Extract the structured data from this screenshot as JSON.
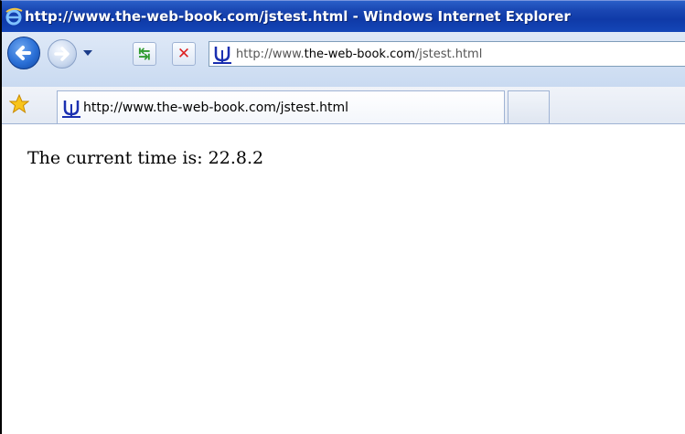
{
  "window": {
    "title": "http://www.the-web-book.com/jstest.html - Windows Internet Explorer"
  },
  "navbar": {
    "address_prefix": "http://www.",
    "address_domain": "the-web-book.com",
    "address_path": "/jstest.html"
  },
  "tab": {
    "title": "http://www.the-web-book.com/jstest.html"
  },
  "page": {
    "text": "The current time is: 22.8.2"
  },
  "colors": {
    "titlebar": "#1a47b3",
    "stop": "#dd2222",
    "refresh": "#2e9b2e"
  },
  "icons": [
    "ie-logo-icon",
    "back-arrow-icon",
    "forward-arrow-icon",
    "dropdown-arrow-icon",
    "refresh-icon",
    "stop-icon",
    "site-favicon-icon",
    "favorites-star-icon"
  ]
}
